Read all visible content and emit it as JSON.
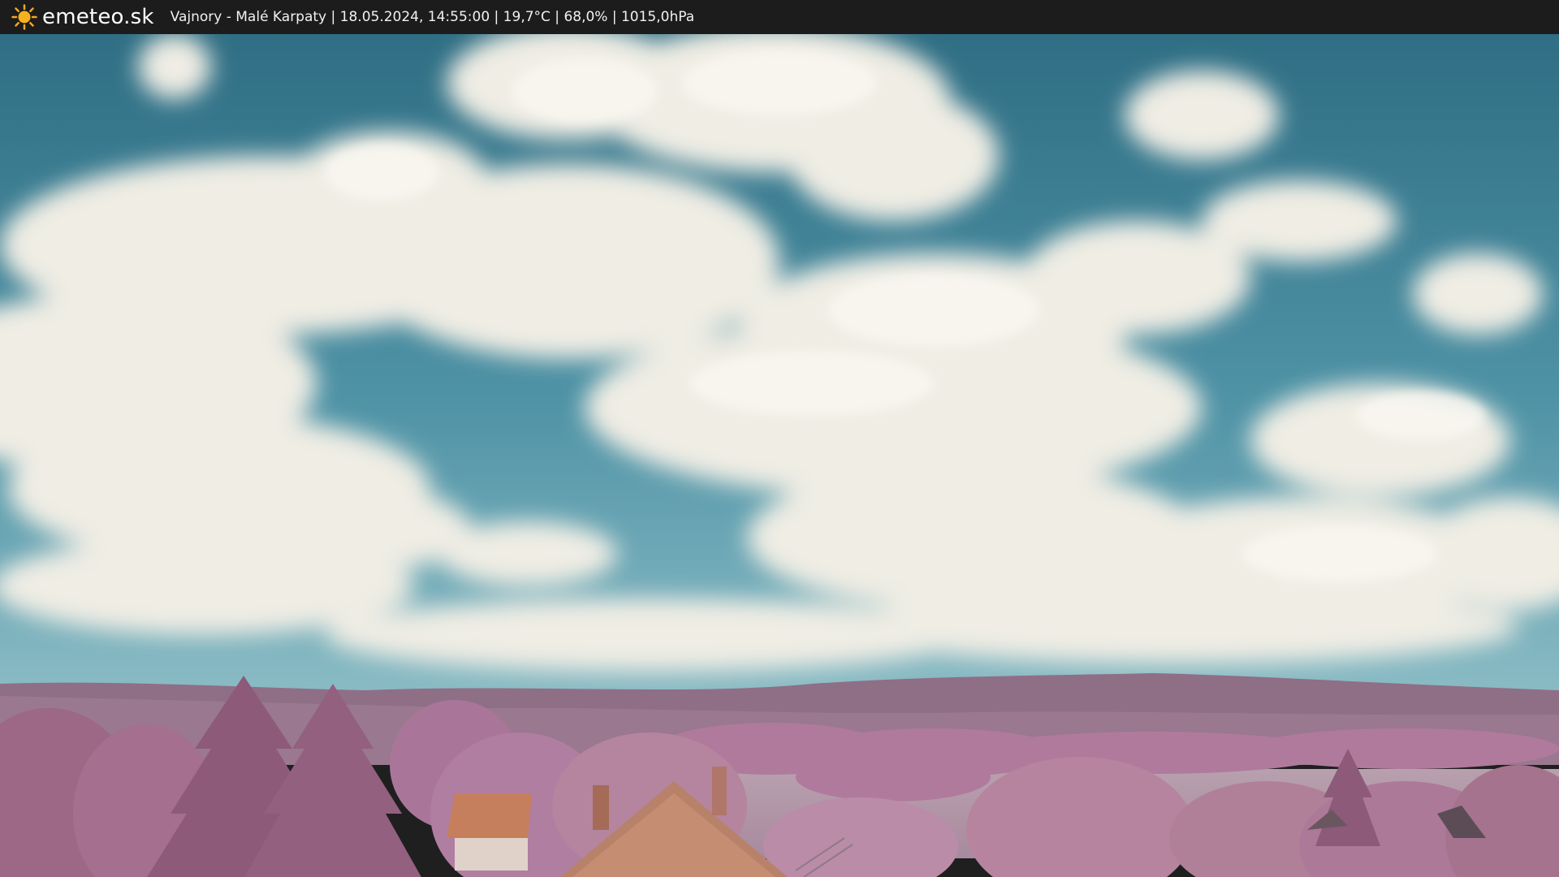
{
  "topbar": {
    "logo_icon": "sun-icon",
    "brand": "emeteo.sk",
    "info": "Vajnory - Malé Karpaty | 18.05.2024, 14:55:00 | 19,7°C | 68,0% | 1015,0hPa"
  },
  "colors": {
    "topbar_bg": "#1c1c1c",
    "sun": "#f5a623",
    "sky_top": "#2f6e84",
    "sky_bottom": "#7fb3bf",
    "cloud": "#f1efe6",
    "hills": "#8f6f86",
    "foliage": "#b37d9f",
    "roof": "#c08060"
  }
}
